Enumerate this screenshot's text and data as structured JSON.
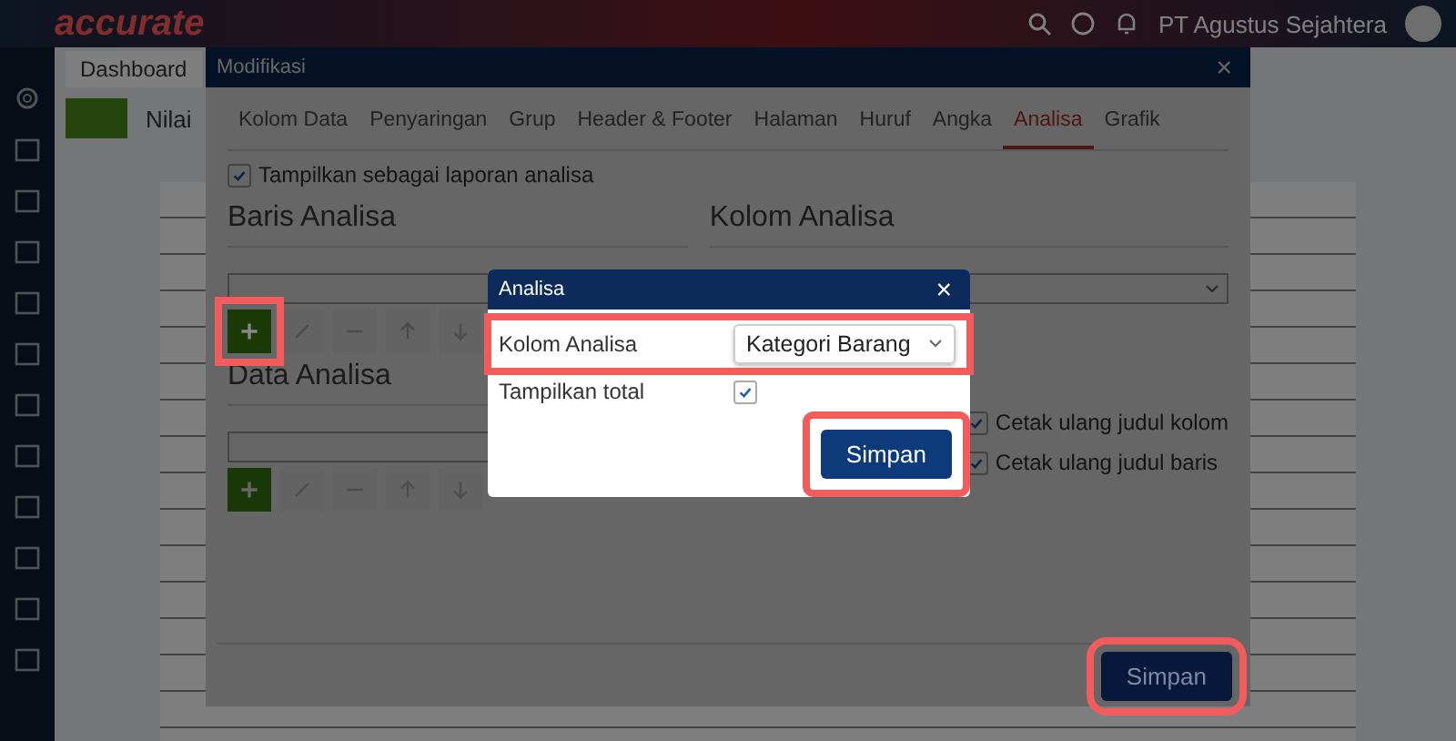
{
  "app": {
    "logo": "accurate",
    "company": "PT Agustus Sejahtera",
    "tabs": [
      "Dashboard"
    ],
    "page_label": "Nilai"
  },
  "modal": {
    "title": "Modifikasi",
    "close": "×",
    "tabs": [
      {
        "label": "Kolom Data",
        "selected": false
      },
      {
        "label": "Penyaringan",
        "selected": false
      },
      {
        "label": "Grup",
        "selected": false
      },
      {
        "label": "Header & Footer",
        "selected": false
      },
      {
        "label": "Halaman",
        "selected": false
      },
      {
        "label": "Huruf",
        "selected": false
      },
      {
        "label": "Angka",
        "selected": false
      },
      {
        "label": "Analisa",
        "selected": true
      },
      {
        "label": "Grafik",
        "selected": false
      }
    ],
    "show_analysis": {
      "label": "Tampilkan sebagai laporan analisa",
      "checked": true
    },
    "row_section": {
      "title": "Baris Analisa",
      "tools": [
        {
          "kind": "add",
          "disabled": false,
          "highlighted": true
        },
        {
          "kind": "edit",
          "disabled": true
        },
        {
          "kind": "remove",
          "disabled": true
        },
        {
          "kind": "up",
          "disabled": true
        },
        {
          "kind": "down",
          "disabled": true
        }
      ]
    },
    "data_section": {
      "title": "Data Analisa",
      "tools": [
        {
          "kind": "add",
          "disabled": false
        },
        {
          "kind": "edit",
          "disabled": true
        },
        {
          "kind": "remove",
          "disabled": true
        },
        {
          "kind": "up",
          "disabled": true
        },
        {
          "kind": "down",
          "disabled": true
        }
      ]
    },
    "column_section": {
      "title": "Kolom Analisa"
    },
    "options": [
      {
        "label": "Cetak ulang judul kolom",
        "checked": true
      },
      {
        "label": "Cetak ulang judul baris",
        "checked": true
      }
    ],
    "save": {
      "label": "Simpan",
      "highlighted": true
    }
  },
  "dialog": {
    "title": "Analisa",
    "close": "×",
    "field": {
      "label": "Kolom Analisa",
      "value": "Kategori Barang",
      "highlighted": true
    },
    "total": {
      "label": "Tampilkan total",
      "checked": true
    },
    "save": {
      "label": "Simpan",
      "highlighted": true
    }
  }
}
